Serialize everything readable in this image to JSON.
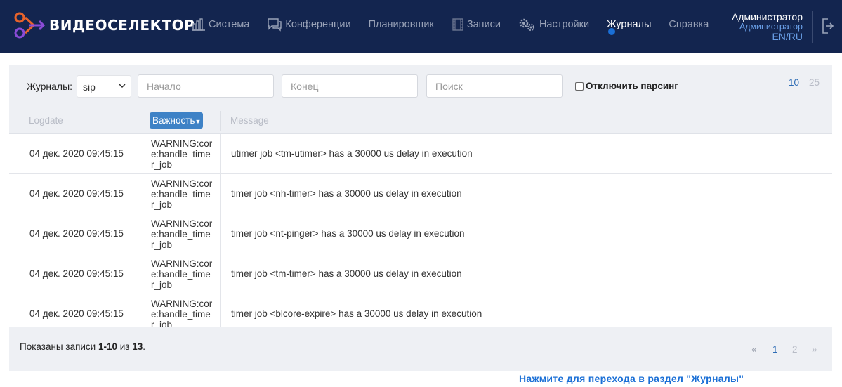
{
  "header": {
    "brand": "ВИДЕОСЕЛЕКТОР",
    "nav": [
      {
        "label": "Система",
        "icon": "bar-chart-icon"
      },
      {
        "label": "Конференции",
        "icon": "chat-icon"
      },
      {
        "label": "Планировщик",
        "icon": ""
      },
      {
        "label": "Записи",
        "icon": "film-icon"
      },
      {
        "label": "Настройки",
        "icon": "gears-icon"
      },
      {
        "label": "Журналы",
        "icon": "",
        "active": true
      },
      {
        "label": "Справка",
        "icon": ""
      }
    ],
    "user_name": "Администратор",
    "user_role": "Администратор",
    "lang": "EN/RU"
  },
  "filters": {
    "journals_label": "Журналы:",
    "journal_value": "sip",
    "start_placeholder": "Начало",
    "end_placeholder": "Конец",
    "search_placeholder": "Поиск",
    "disable_parsing_label": "Отключить парсинг",
    "page_sizes": [
      "10",
      "25"
    ],
    "page_size_selected": "10"
  },
  "table": {
    "columns": [
      "Logdate",
      "Важность",
      "Message"
    ],
    "rows": [
      {
        "date": "04 дек. 2020 09:45:15",
        "severity": "WARNING:core:handle_timer_job",
        "message": "utimer job <tm-utimer> has a 30000 us delay in execution"
      },
      {
        "date": "04 дек. 2020 09:45:15",
        "severity": "WARNING:core:handle_timer_job",
        "message": "timer job <nh-timer> has a 30000 us delay in execution"
      },
      {
        "date": "04 дек. 2020 09:45:15",
        "severity": "WARNING:core:handle_timer_job",
        "message": "timer job <nt-pinger> has a 30000 us delay in execution"
      },
      {
        "date": "04 дек. 2020 09:45:15",
        "severity": "WARNING:core:handle_timer_job",
        "message": "timer job <tm-timer> has a 30000 us delay in execution"
      },
      {
        "date": "04 дек. 2020 09:45:15",
        "severity": "WARNING:core:handle_timer_job",
        "message": "timer job <blcore-expire> has a 30000 us delay in execution"
      }
    ]
  },
  "footer": {
    "shown_prefix": "Показаны записи ",
    "shown_range": "1-10",
    "shown_mid": " из ",
    "shown_total": "13",
    "shown_suffix": ".",
    "pager": [
      "«",
      "1",
      "2",
      "»"
    ]
  },
  "callout": {
    "text": "Нажмите для перехода в раздел \"Журналы\""
  },
  "colors": {
    "header_bg": "#13254f",
    "accent": "#3e82c6",
    "callout": "#1a6fd6"
  }
}
